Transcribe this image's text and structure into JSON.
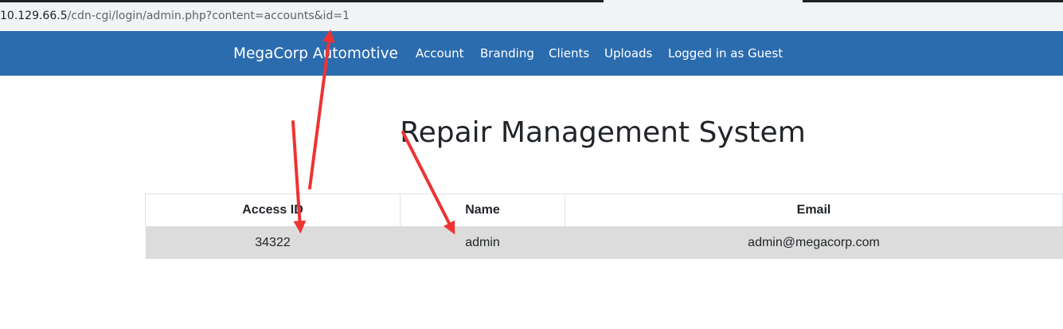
{
  "browser": {
    "url_host": "10.129.66.5",
    "url_path": "/cdn-cgi/login/admin.php?content=accounts&id=1"
  },
  "navbar": {
    "brand": "MegaCorp Automotive",
    "items": [
      "Account",
      "Branding",
      "Clients",
      "Uploads",
      "Logged in as Guest"
    ]
  },
  "main": {
    "title": "Repair Management System"
  },
  "table": {
    "headers": [
      "Access ID",
      "Name",
      "Email"
    ],
    "rows": [
      [
        "34322",
        "admin",
        "admin@megacorp.com"
      ]
    ]
  },
  "colors": {
    "navbar_bg": "#2b6caf",
    "row_bg": "#dcdcdc",
    "annotation_arrow": "#ee3333"
  },
  "annotations": {
    "icon": "red-arrow-icon",
    "count": 3
  }
}
